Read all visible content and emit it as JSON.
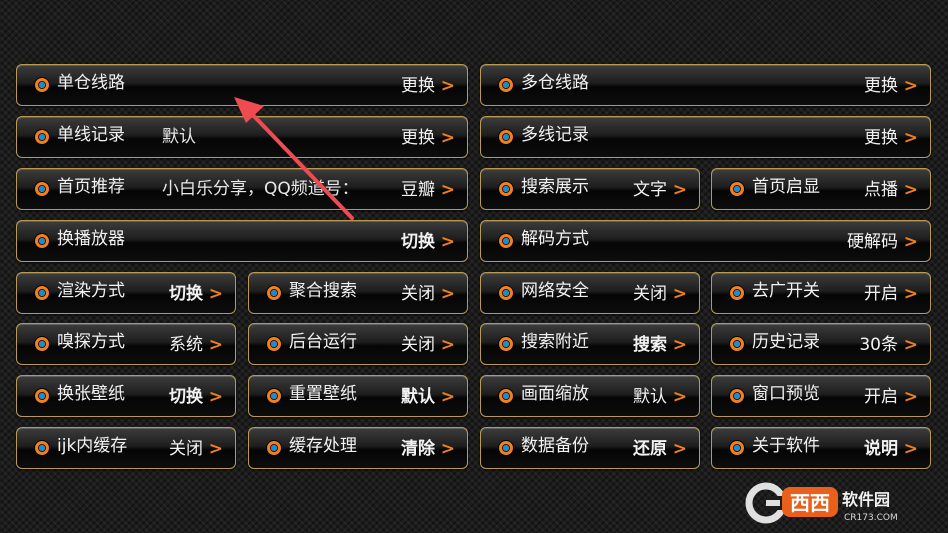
{
  "settings": [
    {
      "label": "单仓线路",
      "value": "更换",
      "bold": false
    },
    {
      "label": "多仓线路",
      "value": "更换",
      "bold": false
    },
    {
      "label": "单线记录",
      "note": "默认",
      "value": "更换",
      "bold": false
    },
    {
      "label": "多线记录",
      "value": "更换",
      "bold": false
    },
    {
      "label": "首页推荐",
      "note": "小白乐分享，QQ频道号：",
      "value": "豆瓣",
      "bold": false
    },
    {
      "label": "搜索展示",
      "value": "文字",
      "bold": false
    },
    {
      "label": "首页启显",
      "value": "点播",
      "bold": false
    },
    {
      "label": "换播放器",
      "value": "切换",
      "bold": true
    },
    {
      "label": "解码方式",
      "value": "硬解码",
      "bold": false
    },
    {
      "label": "渲染方式",
      "value": "切换",
      "bold": true
    },
    {
      "label": "聚合搜索",
      "value": "关闭",
      "bold": false
    },
    {
      "label": "网络安全",
      "value": "关闭",
      "bold": false
    },
    {
      "label": "去广开关",
      "value": "开启",
      "bold": false
    },
    {
      "label": "嗅探方式",
      "value": "系统",
      "bold": false
    },
    {
      "label": "后台运行",
      "value": "关闭",
      "bold": false
    },
    {
      "label": "搜索附近",
      "value": "搜索",
      "bold": true
    },
    {
      "label": "历史记录",
      "value": "30条",
      "bold": false
    },
    {
      "label": "换张壁纸",
      "value": "切换",
      "bold": true
    },
    {
      "label": "重置壁纸",
      "value": "默认",
      "bold": true
    },
    {
      "label": "画面缩放",
      "value": "默认",
      "bold": false
    },
    {
      "label": "窗口预览",
      "value": "开启",
      "bold": false
    },
    {
      "label": "ijk内缓存",
      "value": "关闭",
      "bold": false
    },
    {
      "label": "缓存处理",
      "value": "清除",
      "bold": true
    },
    {
      "label": "数据备份",
      "value": "还原",
      "bold": true
    },
    {
      "label": "关于软件",
      "value": "说明",
      "bold": true
    }
  ],
  "chevron": ">",
  "watermark": {
    "brand": "西西软件园",
    "url": "CR173.COM"
  },
  "colors": {
    "accent": "#f07f1e",
    "border": "#b89a52",
    "arrow": "#ee4b52"
  }
}
